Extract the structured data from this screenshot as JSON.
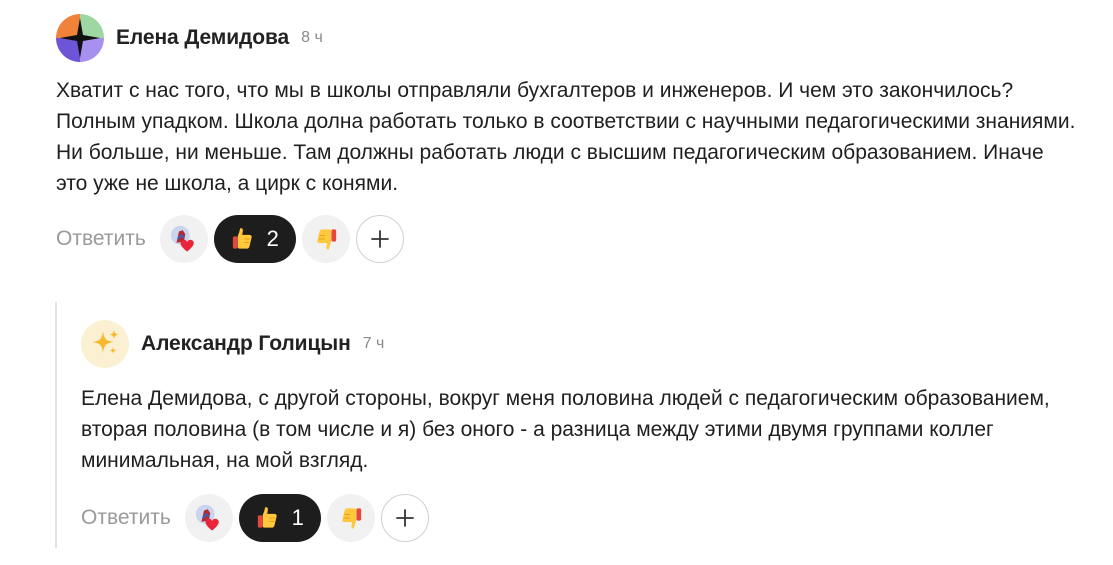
{
  "comments": [
    {
      "author": "Елена Демидова",
      "time": "8 ч",
      "text": "Хватит с нас того, что мы в школы отправляли бухгалтеров и инженеров. И чем это закончилось? Полным упадком. Школа долна работать только в соответствии с научными педагогическими знаниями. Ни больше, ни меньше. Там должны работать люди с высшим педагогическим образованием. Иначе это уже не школа, а цирк с конями.",
      "avatar_icon": "geometric-avatar-icon",
      "reply_label": "Ответить",
      "reactions": [
        {
          "icon": "heart-reaction-icon",
          "count": ""
        },
        {
          "icon": "thumbs-up-icon",
          "count": "2",
          "active": true
        },
        {
          "icon": "thumbs-down-icon",
          "count": ""
        }
      ],
      "add_reaction_icon": "plus-icon"
    },
    {
      "author": "Александр Голицын",
      "time": "7 ч",
      "text": "Елена Демидова, с другой стороны, вокруг меня половина людей с педагогическим образованием, вторая половина (в том числе и я) без оного - а разница между этими двумя группами коллег минимальная, на мой взгляд.",
      "avatar_icon": "sparkles-icon",
      "reply_label": "Ответить",
      "reactions": [
        {
          "icon": "heart-reaction-icon",
          "count": ""
        },
        {
          "icon": "thumbs-up-icon",
          "count": "1",
          "active": true
        },
        {
          "icon": "thumbs-down-icon",
          "count": ""
        }
      ],
      "add_reaction_icon": "plus-icon"
    }
  ],
  "colors": {
    "active_reaction_bg": "#1d1d1d",
    "reaction_bg": "#f1f1f1",
    "muted_text": "#9a9a9a"
  }
}
